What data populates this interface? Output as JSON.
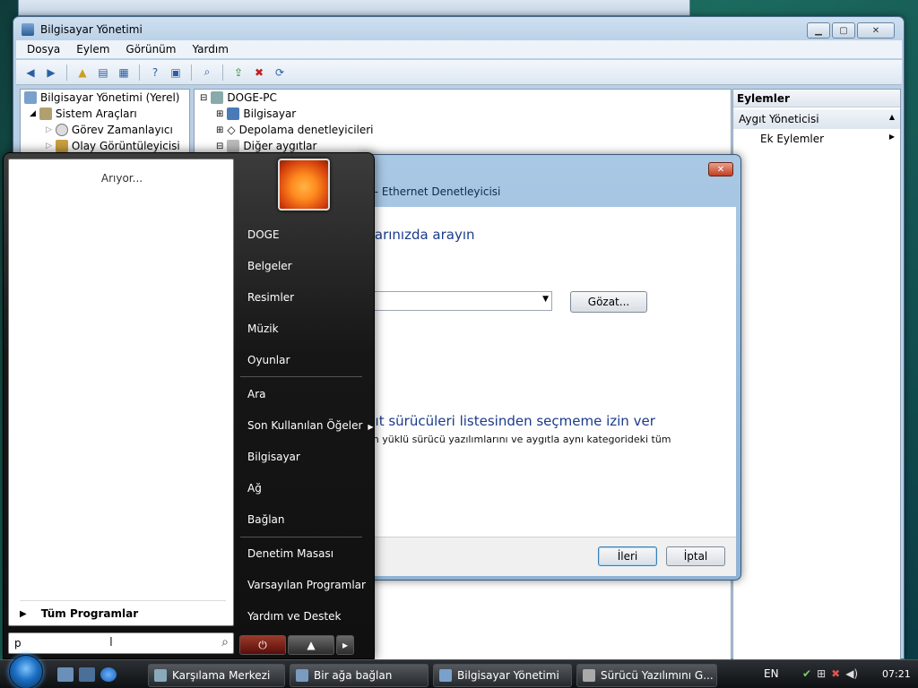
{
  "main_window": {
    "title": "Bilgisayar Yönetimi",
    "menu": [
      "Dosya",
      "Eylem",
      "Görünüm",
      "Yardım"
    ],
    "tree": [
      {
        "label": "Bilgisayar Yönetimi (Yerel)"
      },
      {
        "label": "Sistem Araçları"
      },
      {
        "label": "Görev Zamanlayıcı"
      },
      {
        "label": "Olay Görüntüleyicisi"
      }
    ],
    "devices": [
      {
        "label": "DOGE-PC"
      },
      {
        "label": "Bilgisayar"
      },
      {
        "label": "Depolama denetleyicileri"
      },
      {
        "label": "Diğer aygıtlar"
      }
    ],
    "actions": {
      "header": "Eylemler",
      "item": "Aygıt Yöneticisi",
      "sub_item": "Ek Eylemler"
    }
  },
  "wizard": {
    "title_partial": "r - Ethernet Denetleyicisi",
    "heading_partial": "yarınızda arayın",
    "browse_label": "Gözat...",
    "option_heading_partial": "gıt sürücüleri listesinden seçmeme izin ver",
    "option_desc_partial": "an yüklü sürücü yazılımlarını ve aygıtla aynı kategorideki tüm\nir.",
    "next_label": "İleri",
    "cancel_label": "İptal"
  },
  "start_menu": {
    "searching_label": "Arıyor...",
    "all_programs": "Tüm Programlar",
    "search_value": "p",
    "right_items": [
      "DOGE",
      "Belgeler",
      "Resimler",
      "Müzik",
      "Oyunlar",
      "Ara",
      "Son Kullanılan Öğeler",
      "Bilgisayar",
      "Ağ",
      "Bağlan",
      "Denetim Masası",
      "Varsayılan Programlar",
      "Yardım ve Destek"
    ]
  },
  "taskbar": {
    "tasks": [
      {
        "label": "Karşılama Merkezi"
      },
      {
        "label": "Bir ağa bağlan"
      },
      {
        "label": "Bilgisayar Yönetimi"
      },
      {
        "label": "Sürücü Yazılımını G..."
      }
    ],
    "language": "EN",
    "clock": "07:21"
  }
}
